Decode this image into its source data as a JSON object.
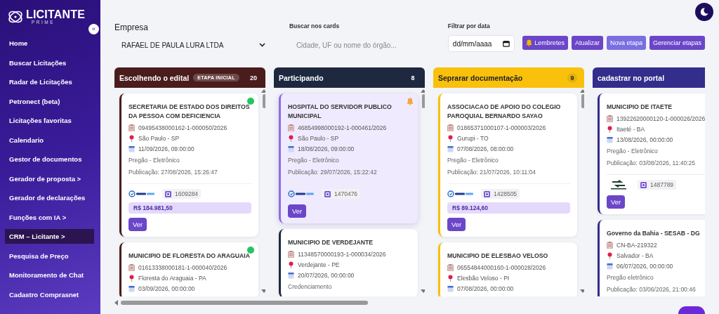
{
  "sidebar": {
    "logo": {
      "title": "LICITANTE",
      "subtitle": "PRIME"
    },
    "collapse_button": "«",
    "items": [
      {
        "label": "Home",
        "selected": false
      },
      {
        "label": "Buscar Licitações",
        "selected": false
      },
      {
        "label": "Radar de Licitações",
        "selected": false
      },
      {
        "label": "Petronect (beta)",
        "selected": false
      },
      {
        "label": "Licitações favoritas",
        "selected": false
      },
      {
        "label": "Calendario",
        "selected": false
      },
      {
        "label": "Gestor de documentos",
        "selected": false
      },
      {
        "label": "Gerador de proposta >",
        "selected": false
      },
      {
        "label": "Gerador de declarações",
        "selected": false
      },
      {
        "label": "Funções com IA >",
        "selected": false
      },
      {
        "label": "CRM – Licitante >",
        "selected": true
      },
      {
        "label": "Pesquisa de Preço",
        "selected": false
      },
      {
        "label": "Monitoramento de Chat",
        "selected": false
      },
      {
        "label": "Cadastro Comprasnet",
        "selected": false
      }
    ]
  },
  "toolbar": {
    "company": {
      "label": "Empresa",
      "value": "RAFAEL DE PAULA LURA LTDA"
    },
    "search": {
      "label": "Buscar nos cards",
      "placeholder": "Cidade, UF ou nome do órgão..."
    },
    "date_filter": {
      "label": "Filtrar por data",
      "placeholder": "dd/mm/aaaa"
    },
    "buttons": [
      {
        "label": "Lembretes",
        "kind": "bell"
      },
      {
        "label": "Atualizar",
        "kind": "plain"
      },
      {
        "label": "Nova etapa",
        "kind": "light"
      },
      {
        "label": "Gerenciar etapas",
        "kind": "plain"
      }
    ]
  },
  "board": {
    "columns": [
      {
        "title": "Escolhendo o edital",
        "badge": "ETAPA INICIAL",
        "count": "20",
        "color": "#4b1c1c",
        "cards": [
          {
            "title": "SECRETARIA DE ESTADO DOS DIREITOS DA PESSOA COM DEFICIENCIA",
            "online": true,
            "reminder": false,
            "selected": false,
            "process": "09495438000162-1-000050/2026",
            "location": "São Paulo - SP",
            "date": "11/09/2026, 09:00:00",
            "modality": "Pregão - Eletrônico",
            "publication": "Publicação: 27/08/2026, 15:26:47",
            "portal": {
              "kind": "compras",
              "id": "1609284"
            },
            "value": "R$ 184.981,50",
            "button": "Ver"
          },
          {
            "title": "MUNICIPIO DE FLORESTA DO ARAGUAIA",
            "online": true,
            "reminder": false,
            "selected": false,
            "process": "01613338000181-1-000040/2026",
            "location": "Floresta do Araguaia - PA",
            "date": "03/09/2026, 00:00:00"
          }
        ]
      },
      {
        "title": "Participando",
        "count": "8",
        "color": "#1e2940",
        "cards": [
          {
            "title": "HOSPITAL DO SERVIDOR PUBLICO MUNICIPAL",
            "online": false,
            "reminder": true,
            "selected": true,
            "process": "46854998000192-1-000461/2026",
            "location": "São Paulo - SP",
            "date": "18/08/2026, 09:00:00",
            "modality": "Pregão - Eletrônico",
            "publication": "Publicação: 29/07/2026, 15:22:42",
            "portal": {
              "kind": "compras",
              "id": "1470476"
            },
            "button": "Ver"
          },
          {
            "title": "MUNICIPIO DE VERDEJANTE",
            "online": false,
            "reminder": false,
            "selected": false,
            "process": "11348570000193-1-000034/2026",
            "location": "Verdejante - PE",
            "date": "20/07/2026, 00:00:00",
            "modality": "Credenciamento"
          }
        ]
      },
      {
        "title": "Seprarar documentação",
        "count": "9",
        "color": "#f9c00c",
        "cards": [
          {
            "title": "ASSOCIACAO DE APOIO DO COLEGIO PAROQUIAL BERNARDO SAYAO",
            "online": false,
            "reminder": false,
            "selected": false,
            "process": "01865371000107-1-000003/2026",
            "location": "Gurupi - TO",
            "date": "07/08/2026, 08:00:00",
            "modality": "Pregão - Eletrônico",
            "publication": "Publicação: 21/07/2026, 10:11:04",
            "portal": {
              "kind": "compras",
              "id": "1428505"
            },
            "value": "R$ 89.124,60",
            "button": "Ver"
          },
          {
            "title": "MUNICIPIO DE ELESBAO VELOSO",
            "online": false,
            "reminder": false,
            "selected": false,
            "process": "06554844000160-1-000028/2026",
            "location": "Elesbão Veloso - PI",
            "date": "07/08/2026, 00:00:00"
          }
        ]
      },
      {
        "title": "cadastrar no portal",
        "color": "#332d8c",
        "cards": [
          {
            "title": "MUNICIPIO DE ITAETE",
            "online": false,
            "reminder": false,
            "selected": false,
            "process": "13922620000120-1-000026/2026",
            "location": "Itaeté - BA",
            "date": "13/08/2026, 00:00:00",
            "modality": "Pregão - Eletrônico",
            "publication": "Publicação: 03/08/2026, 11:40:25",
            "portal": {
              "kind": "bll",
              "id": "1487789"
            },
            "button": "Ver"
          },
          {
            "title": "Governo da Bahia - SESAB - DG",
            "online": false,
            "reminder": false,
            "selected": false,
            "process": "CN-BA-219322",
            "location": "Salvador - BA",
            "date": "06/07/2026, 00:00:00",
            "modality": "Pregão eletrônico",
            "publication": "Publicação: 03/06/2026, 21:00:46"
          }
        ]
      }
    ]
  }
}
